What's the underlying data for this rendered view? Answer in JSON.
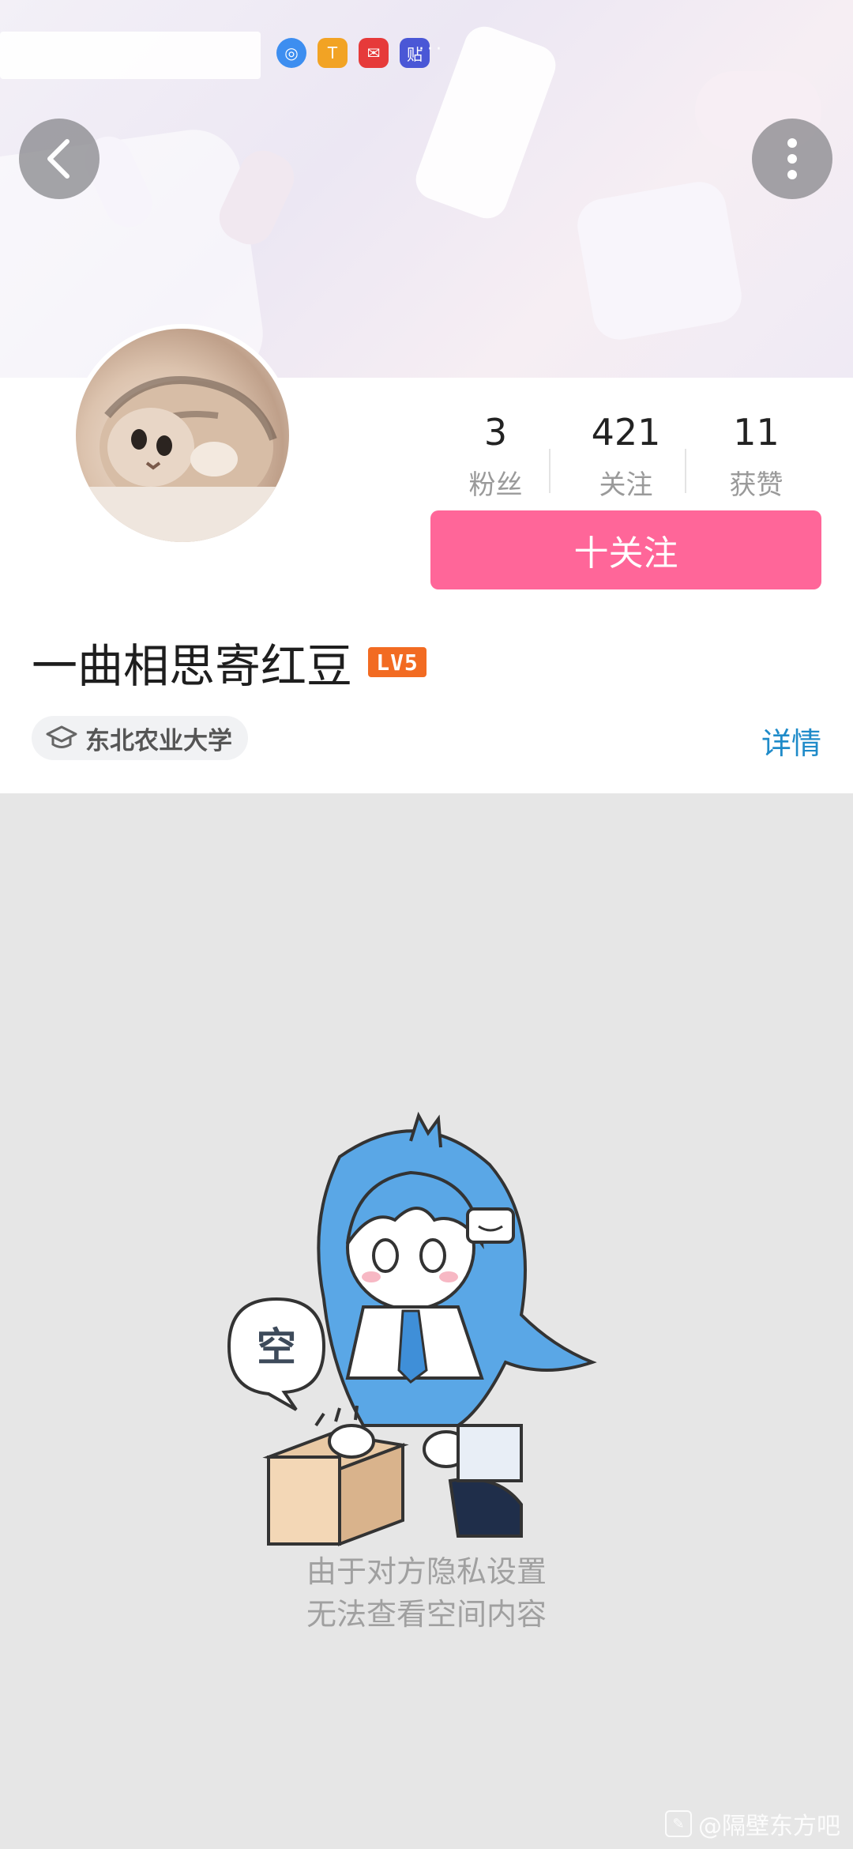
{
  "status_bar": {
    "icons": [
      "network-app-icon",
      "toutiao-app-icon",
      "huawei-app-icon",
      "tieba-app-icon"
    ],
    "more": "···"
  },
  "header": {
    "back_icon": "chevron-left-icon",
    "more_icon": "vertical-dots-icon"
  },
  "profile": {
    "stats": [
      {
        "value": "3",
        "label": "粉丝"
      },
      {
        "value": "421",
        "label": "关注"
      },
      {
        "value": "11",
        "label": "获赞"
      }
    ],
    "follow_label": "十关注",
    "username": "一曲相思寄红豆",
    "level": "LV5",
    "school": "东北农业大学",
    "detail_link": "详情"
  },
  "empty_state": {
    "bubble_text": "空",
    "line1": "由于对方隐私设置",
    "line2": "无法查看空间内容"
  },
  "watermark": "@隔壁东方吧",
  "colors": {
    "accent": "#ff6699",
    "link": "#1f8bc9",
    "level_badge": "#f26b22",
    "empty_bg": "#e6e6e6"
  }
}
